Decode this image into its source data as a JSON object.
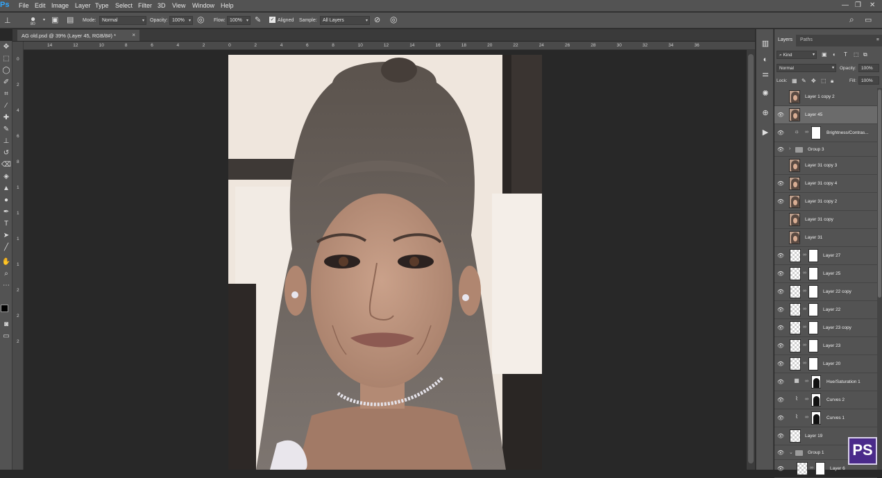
{
  "app": {
    "logo": "Ps"
  },
  "menu": [
    "File",
    "Edit",
    "Image",
    "Layer",
    "Type",
    "Select",
    "Filter",
    "3D",
    "View",
    "Window",
    "Help"
  ],
  "options": {
    "brush_size": "80",
    "mode_label": "Mode:",
    "mode_value": "Normal",
    "opacity_label": "Opacity:",
    "opacity_value": "100%",
    "flow_label": "Flow:",
    "flow_value": "100%",
    "aligned_label": "Aligned",
    "aligned_checked": true,
    "sample_label": "Sample:",
    "sample_value": "All Layers"
  },
  "document": {
    "tab_title": "AG old.psd @ 39% (Layer 45, RGB/8#) *"
  },
  "ruler_top": [
    "14",
    "12",
    "10",
    "8",
    "6",
    "4",
    "2",
    "0",
    "2",
    "4",
    "6",
    "8",
    "10",
    "12",
    "14",
    "16",
    "18",
    "20",
    "22",
    "24",
    "26",
    "28",
    "30",
    "32",
    "34",
    "36"
  ],
  "ruler_left": [
    "0",
    "2",
    "4",
    "6",
    "8",
    "1",
    "1",
    "1",
    "1",
    "2",
    "2",
    "2"
  ],
  "panel": {
    "tabs": [
      "Layers",
      "Paths"
    ],
    "filter_kind": "Kind",
    "blend_mode": "Normal",
    "opacity_label": "Opacity:",
    "opacity_value": "100%",
    "lock_label": "Lock:",
    "fill_label": "Fill:",
    "fill_value": "100%"
  },
  "layers": [
    {
      "name": "Layer 1 copy 2",
      "visible": false,
      "thumb": "face",
      "selected": false
    },
    {
      "name": "Layer 45",
      "visible": true,
      "thumb": "face",
      "selected": true
    },
    {
      "name": "Brightness/Contras...",
      "visible": true,
      "thumb": "adjust",
      "selected": false
    },
    {
      "name": "Group 3",
      "visible": true,
      "thumb": "group",
      "selected": false
    },
    {
      "name": "Layer 31 copy 3",
      "visible": false,
      "thumb": "face",
      "selected": false
    },
    {
      "name": "Layer 31 copy 4",
      "visible": true,
      "thumb": "face",
      "selected": false
    },
    {
      "name": "Layer 31 copy 2",
      "visible": true,
      "thumb": "face",
      "selected": false
    },
    {
      "name": "Layer 31 copy",
      "visible": false,
      "thumb": "face",
      "selected": false
    },
    {
      "name": "Layer 31",
      "visible": false,
      "thumb": "face",
      "selected": false
    },
    {
      "name": "Layer 27",
      "visible": true,
      "thumb": "checker-mask",
      "selected": false
    },
    {
      "name": "Layer 25",
      "visible": true,
      "thumb": "checker-mask",
      "selected": false
    },
    {
      "name": "Layer 22 copy",
      "visible": true,
      "thumb": "checker-mask",
      "selected": false
    },
    {
      "name": "Layer 22",
      "visible": true,
      "thumb": "checker-mask",
      "selected": false
    },
    {
      "name": "Layer 23 copy",
      "visible": true,
      "thumb": "checker-mask",
      "selected": false
    },
    {
      "name": "Layer 23",
      "visible": true,
      "thumb": "checker-mask",
      "selected": false
    },
    {
      "name": "Layer 20",
      "visible": true,
      "thumb": "checker-mask",
      "selected": false
    },
    {
      "name": "Hue/Saturation 1",
      "visible": true,
      "thumb": "hue-mask",
      "selected": false
    },
    {
      "name": "Curves 2",
      "visible": true,
      "thumb": "curves-mask",
      "selected": false
    },
    {
      "name": "Curves 1",
      "visible": true,
      "thumb": "curves-mask",
      "selected": false
    },
    {
      "name": "Layer 19",
      "visible": true,
      "thumb": "checker",
      "selected": false
    },
    {
      "name": "Group 1",
      "visible": true,
      "thumb": "group-open",
      "selected": false
    },
    {
      "name": "Layer 6",
      "visible": true,
      "thumb": "checker-mask-indent",
      "selected": false
    }
  ],
  "watermark": "PS"
}
